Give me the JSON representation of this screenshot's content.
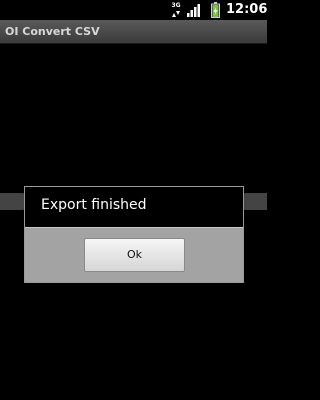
{
  "status_bar": {
    "network_type": "3G",
    "time": "12:06",
    "icons": {
      "network_arrows": "data-activity-icon",
      "signal": "signal-strength-icon",
      "battery": "battery-charging-icon"
    },
    "colors": {
      "battery_fill": "#7bc043",
      "signal": "#ffffff"
    }
  },
  "app": {
    "title": "OI Convert CSV"
  },
  "dialog": {
    "message": "Export finished",
    "ok_label": "Ok"
  }
}
